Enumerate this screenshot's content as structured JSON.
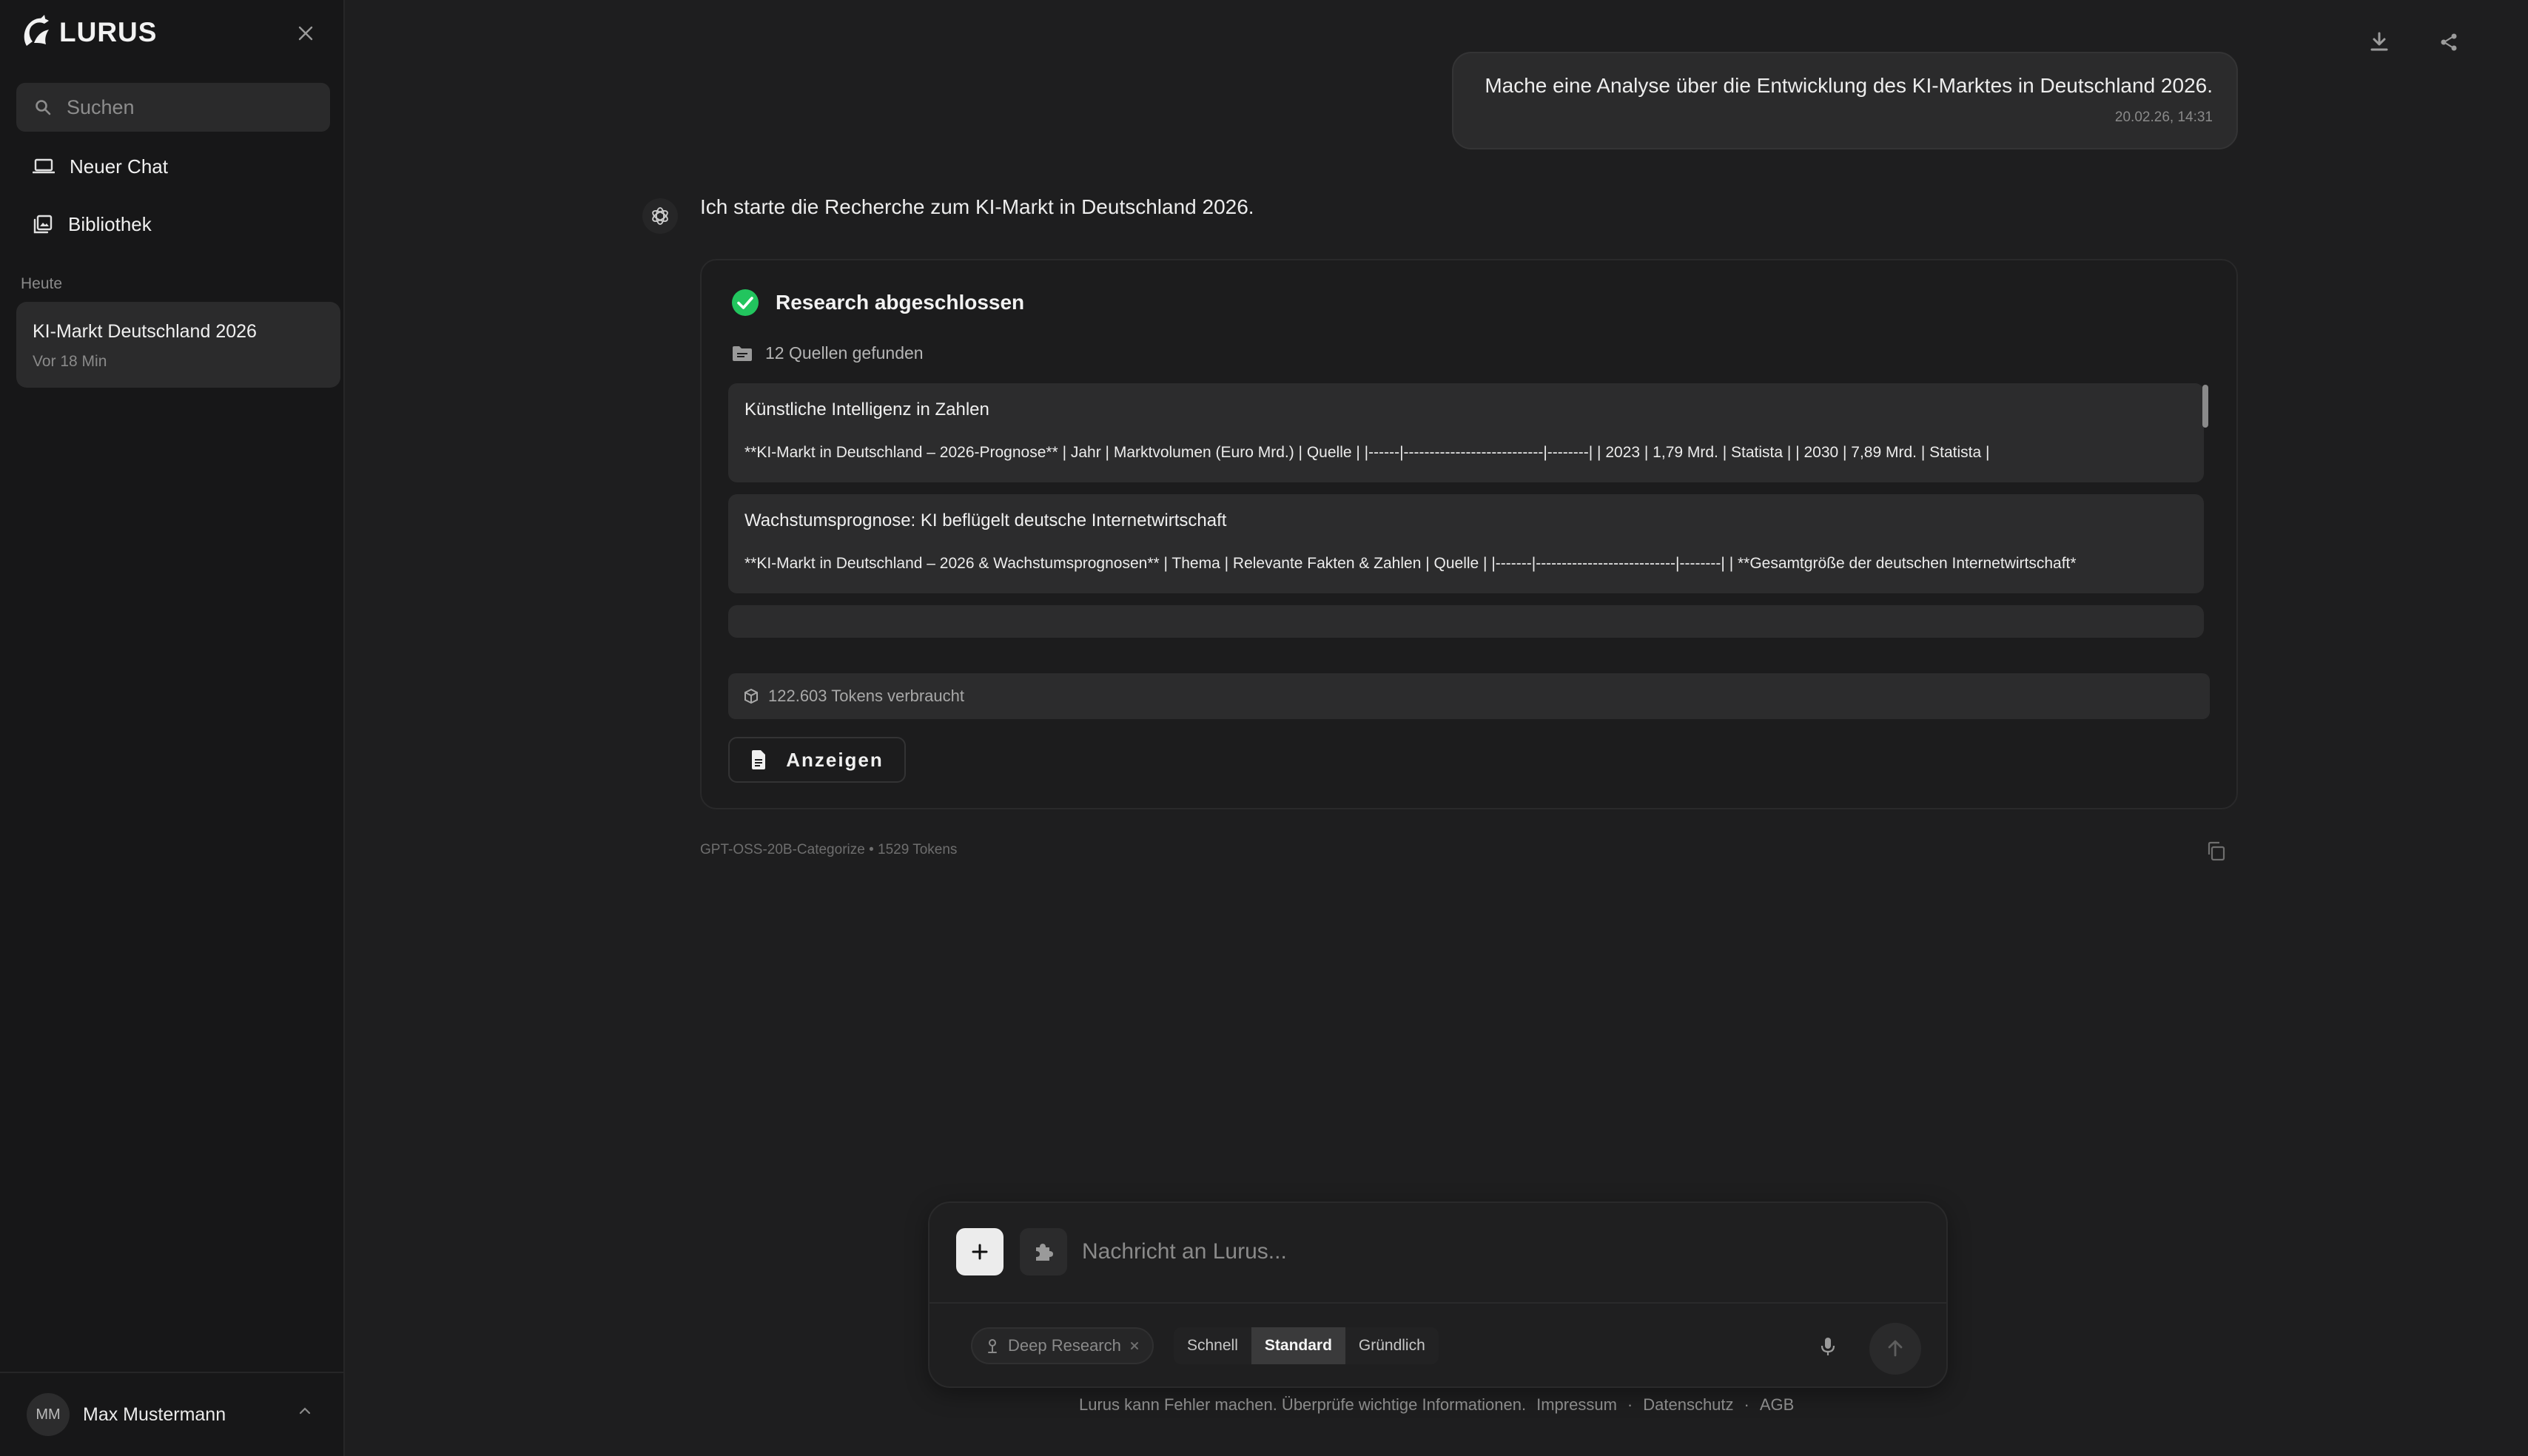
{
  "sidebar": {
    "logo_text": "LURUS",
    "search_placeholder": "Suchen",
    "nav": [
      {
        "label": "Neuer Chat",
        "icon": "laptop-icon"
      },
      {
        "label": "Bibliothek",
        "icon": "library-icon"
      }
    ],
    "section_today": "Heute",
    "chats": [
      {
        "title": "KI-Markt Deutschland 2026",
        "time": "Vor 18 Min"
      }
    ],
    "user": {
      "initials": "MM",
      "name": "Max Mustermann"
    }
  },
  "conversation": {
    "user_message": {
      "text": "Mache eine Analyse über die Entwicklung des KI-Marktes in Deutschland 2026.",
      "time": "20.02.26, 14:31"
    },
    "assistant": {
      "intro": "Ich starte die Recherche zum KI-Markt in Deutschland 2026.",
      "research": {
        "status": "Research abgeschlossen",
        "sources_found": "12 Quellen gefunden",
        "sources": [
          {
            "title": "Künstliche Intelligenz in Zahlen",
            "snippet": "**KI-Markt in Deutschland – 2026-Prognose** | Jahr | Marktvolumen (Euro Mrd.) | Quelle | |------|---------------------------|--------| | 2023 | 1,79 Mrd. | Statista | | 2030 | 7,89 Mrd. | Statista |"
          },
          {
            "title": "Wachstumsprognose: KI beflügelt deutsche Internetwirtschaft",
            "snippet": "**KI-Markt in Deutschland – 2026 & Wachstumsprognosen** | Thema | Relevante Fakten & Zahlen | Quelle | |-------|---------------------------|--------| | **Gesamtgröße der deutschen Internetwirtschaft*"
          }
        ],
        "tokens_used": "122.603 Tokens verbraucht",
        "show_button": "Anzeigen"
      },
      "meta": "GPT-OSS-20B-Categorize • 1529 Tokens"
    }
  },
  "composer": {
    "placeholder": "Nachricht an Lurus...",
    "research_chip": "Deep Research",
    "modes": [
      "Schnell",
      "Standard",
      "Gründlich"
    ],
    "active_mode": "Standard"
  },
  "footer": {
    "disclaimer": "Lurus kann Fehler machen. Überprüfe wichtige Informationen.",
    "links": [
      "Impressum",
      "Datenschutz",
      "AGB"
    ]
  },
  "colors": {
    "background": "#1e1e1f",
    "sidebar": "#171718",
    "success": "#22c55e"
  }
}
